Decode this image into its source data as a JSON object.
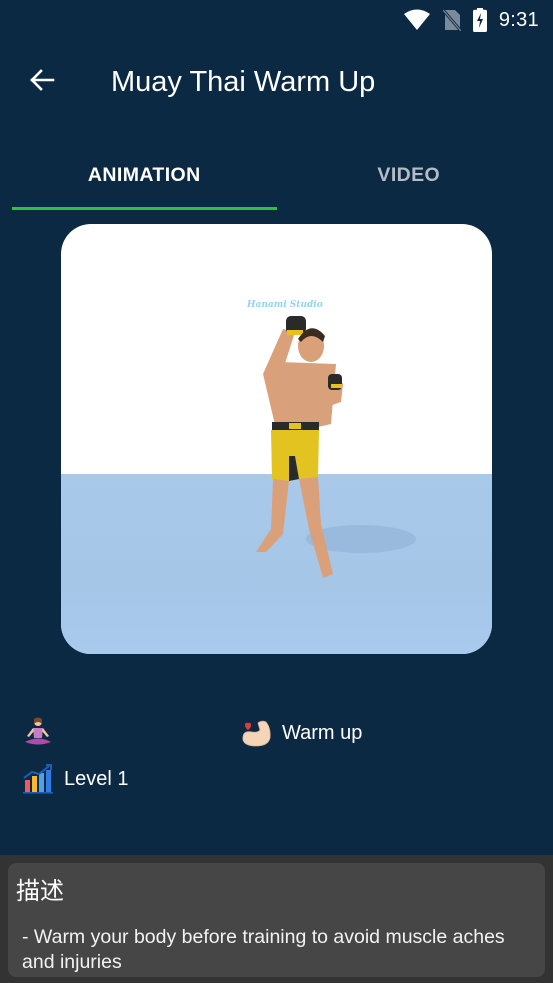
{
  "status_bar": {
    "time": "9:31",
    "icons": [
      "wifi-icon",
      "no-sim-icon",
      "battery-charging-icon"
    ]
  },
  "app_bar": {
    "back_icon": "arrow-left-icon",
    "title": "Muay Thai Warm Up"
  },
  "tabs": [
    {
      "label": "ANIMATION",
      "active": true
    },
    {
      "label": "VIDEO",
      "active": false
    }
  ],
  "accent_color": "#2ec13e",
  "media": {
    "watermark": "Hanami Studio",
    "description": "3D animated fighter in yellow shorts performing warm up"
  },
  "info": {
    "category_icon": "yoga-person-icon",
    "category_label": "",
    "type_icon": "flexed-biceps-icon",
    "type_label": "Warm up",
    "level_icon": "bar-chart-rising-icon",
    "level_label": "Level 1"
  },
  "description": {
    "title": "描述",
    "text": "- Warm your body before training to avoid muscle aches and injuries"
  }
}
